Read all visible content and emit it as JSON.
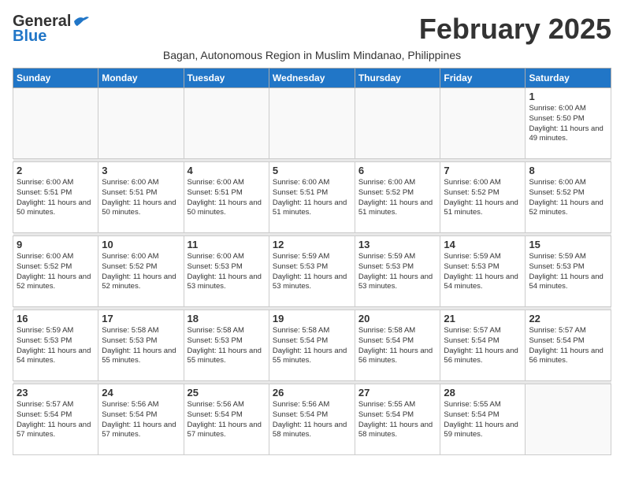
{
  "header": {
    "logo_general": "General",
    "logo_blue": "Blue",
    "month_title": "February 2025",
    "subtitle": "Bagan, Autonomous Region in Muslim Mindanao, Philippines"
  },
  "columns": [
    "Sunday",
    "Monday",
    "Tuesday",
    "Wednesday",
    "Thursday",
    "Friday",
    "Saturday"
  ],
  "weeks": [
    {
      "days": [
        {
          "num": "",
          "info": ""
        },
        {
          "num": "",
          "info": ""
        },
        {
          "num": "",
          "info": ""
        },
        {
          "num": "",
          "info": ""
        },
        {
          "num": "",
          "info": ""
        },
        {
          "num": "",
          "info": ""
        },
        {
          "num": "1",
          "info": "Sunrise: 6:00 AM\nSunset: 5:50 PM\nDaylight: 11 hours and 49 minutes."
        }
      ]
    },
    {
      "days": [
        {
          "num": "2",
          "info": "Sunrise: 6:00 AM\nSunset: 5:51 PM\nDaylight: 11 hours and 50 minutes."
        },
        {
          "num": "3",
          "info": "Sunrise: 6:00 AM\nSunset: 5:51 PM\nDaylight: 11 hours and 50 minutes."
        },
        {
          "num": "4",
          "info": "Sunrise: 6:00 AM\nSunset: 5:51 PM\nDaylight: 11 hours and 50 minutes."
        },
        {
          "num": "5",
          "info": "Sunrise: 6:00 AM\nSunset: 5:51 PM\nDaylight: 11 hours and 51 minutes."
        },
        {
          "num": "6",
          "info": "Sunrise: 6:00 AM\nSunset: 5:52 PM\nDaylight: 11 hours and 51 minutes."
        },
        {
          "num": "7",
          "info": "Sunrise: 6:00 AM\nSunset: 5:52 PM\nDaylight: 11 hours and 51 minutes."
        },
        {
          "num": "8",
          "info": "Sunrise: 6:00 AM\nSunset: 5:52 PM\nDaylight: 11 hours and 52 minutes."
        }
      ]
    },
    {
      "days": [
        {
          "num": "9",
          "info": "Sunrise: 6:00 AM\nSunset: 5:52 PM\nDaylight: 11 hours and 52 minutes."
        },
        {
          "num": "10",
          "info": "Sunrise: 6:00 AM\nSunset: 5:52 PM\nDaylight: 11 hours and 52 minutes."
        },
        {
          "num": "11",
          "info": "Sunrise: 6:00 AM\nSunset: 5:53 PM\nDaylight: 11 hours and 53 minutes."
        },
        {
          "num": "12",
          "info": "Sunrise: 5:59 AM\nSunset: 5:53 PM\nDaylight: 11 hours and 53 minutes."
        },
        {
          "num": "13",
          "info": "Sunrise: 5:59 AM\nSunset: 5:53 PM\nDaylight: 11 hours and 53 minutes."
        },
        {
          "num": "14",
          "info": "Sunrise: 5:59 AM\nSunset: 5:53 PM\nDaylight: 11 hours and 54 minutes."
        },
        {
          "num": "15",
          "info": "Sunrise: 5:59 AM\nSunset: 5:53 PM\nDaylight: 11 hours and 54 minutes."
        }
      ]
    },
    {
      "days": [
        {
          "num": "16",
          "info": "Sunrise: 5:59 AM\nSunset: 5:53 PM\nDaylight: 11 hours and 54 minutes."
        },
        {
          "num": "17",
          "info": "Sunrise: 5:58 AM\nSunset: 5:53 PM\nDaylight: 11 hours and 55 minutes."
        },
        {
          "num": "18",
          "info": "Sunrise: 5:58 AM\nSunset: 5:53 PM\nDaylight: 11 hours and 55 minutes."
        },
        {
          "num": "19",
          "info": "Sunrise: 5:58 AM\nSunset: 5:54 PM\nDaylight: 11 hours and 55 minutes."
        },
        {
          "num": "20",
          "info": "Sunrise: 5:58 AM\nSunset: 5:54 PM\nDaylight: 11 hours and 56 minutes."
        },
        {
          "num": "21",
          "info": "Sunrise: 5:57 AM\nSunset: 5:54 PM\nDaylight: 11 hours and 56 minutes."
        },
        {
          "num": "22",
          "info": "Sunrise: 5:57 AM\nSunset: 5:54 PM\nDaylight: 11 hours and 56 minutes."
        }
      ]
    },
    {
      "days": [
        {
          "num": "23",
          "info": "Sunrise: 5:57 AM\nSunset: 5:54 PM\nDaylight: 11 hours and 57 minutes."
        },
        {
          "num": "24",
          "info": "Sunrise: 5:56 AM\nSunset: 5:54 PM\nDaylight: 11 hours and 57 minutes."
        },
        {
          "num": "25",
          "info": "Sunrise: 5:56 AM\nSunset: 5:54 PM\nDaylight: 11 hours and 57 minutes."
        },
        {
          "num": "26",
          "info": "Sunrise: 5:56 AM\nSunset: 5:54 PM\nDaylight: 11 hours and 58 minutes."
        },
        {
          "num": "27",
          "info": "Sunrise: 5:55 AM\nSunset: 5:54 PM\nDaylight: 11 hours and 58 minutes."
        },
        {
          "num": "28",
          "info": "Sunrise: 5:55 AM\nSunset: 5:54 PM\nDaylight: 11 hours and 59 minutes."
        },
        {
          "num": "",
          "info": ""
        }
      ]
    }
  ]
}
